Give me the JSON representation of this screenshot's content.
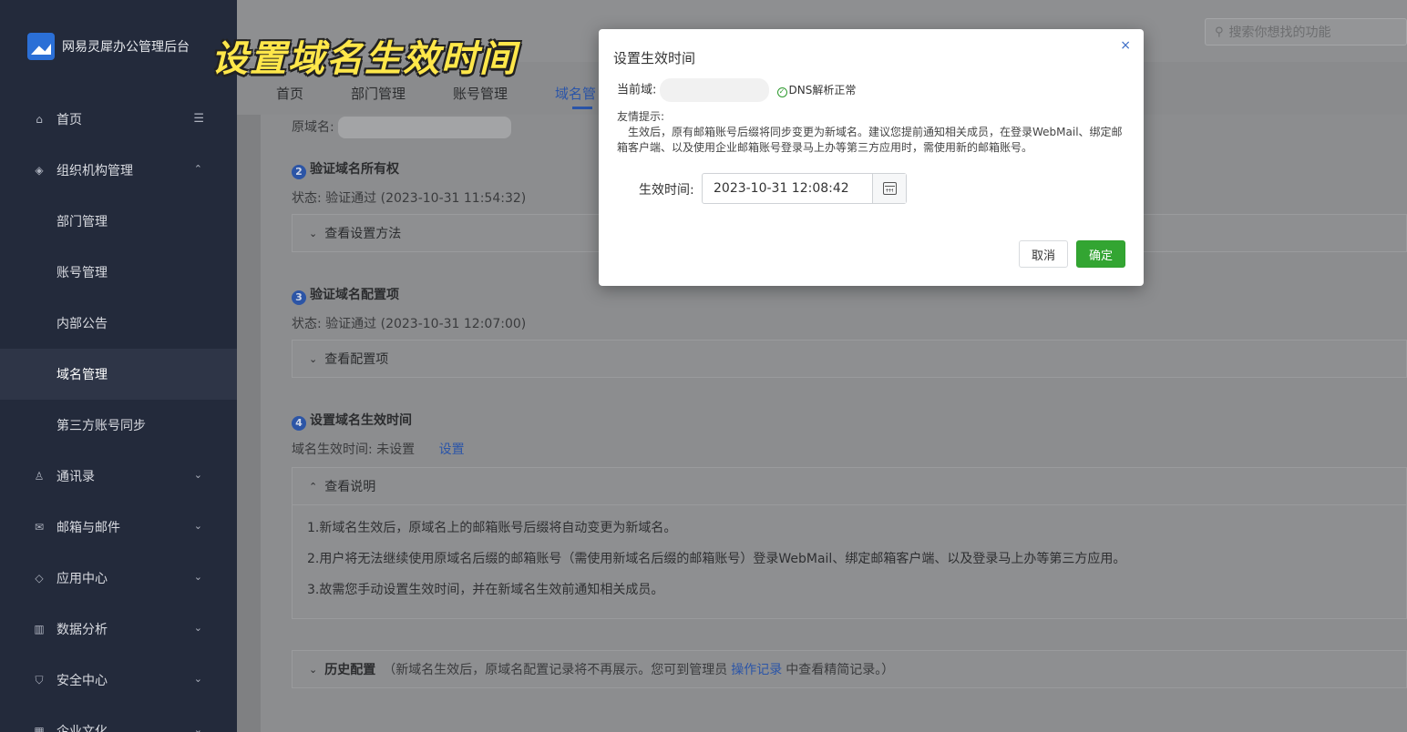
{
  "overlay_title": "设置域名生效时间",
  "sidebar": {
    "brand": "网易灵犀办公管理后台",
    "items": [
      {
        "label": "首页",
        "icon": "home-icon",
        "glyph": "⌂",
        "type": "top",
        "extra": "collapse"
      },
      {
        "label": "组织机构管理",
        "icon": "layers-icon",
        "glyph": "◈",
        "type": "top",
        "arrow": "^"
      },
      {
        "label": "部门管理",
        "type": "sub"
      },
      {
        "label": "账号管理",
        "type": "sub"
      },
      {
        "label": "内部公告",
        "type": "sub"
      },
      {
        "label": "域名管理",
        "type": "sub",
        "active": true
      },
      {
        "label": "第三方账号同步",
        "type": "sub"
      },
      {
        "label": "通讯录",
        "icon": "user-icon",
        "glyph": "♙",
        "type": "top",
        "arrow": "v"
      },
      {
        "label": "邮箱与邮件",
        "icon": "mail-icon",
        "glyph": "✉",
        "type": "top",
        "arrow": "v"
      },
      {
        "label": "应用中心",
        "icon": "diamond-icon",
        "glyph": "◇",
        "type": "top",
        "arrow": "v"
      },
      {
        "label": "数据分析",
        "icon": "chart-icon",
        "glyph": "▥",
        "type": "top",
        "arrow": "v"
      },
      {
        "label": "安全中心",
        "icon": "shield-icon",
        "glyph": "⛉",
        "type": "top",
        "arrow": "v"
      },
      {
        "label": "企业文化",
        "icon": "culture-icon",
        "glyph": "▦",
        "type": "top",
        "arrow": "v"
      }
    ]
  },
  "header": {
    "search_placeholder": "搜索你想找的功能",
    "tabs": [
      "首页",
      "部门管理",
      "账号管理",
      "域名管"
    ]
  },
  "content": {
    "original_domain_label": "原域名:",
    "step2": {
      "num": "2",
      "title": "验证域名所有权",
      "status": "状态:  验证通过  (2023-10-31 11:54:32)",
      "collapse": "查看设置方法"
    },
    "step3": {
      "num": "3",
      "title": "验证域名配置项",
      "status": "状态: 验证通过 (2023-10-31 12:07:00)",
      "collapse": "查看配置项"
    },
    "step4": {
      "num": "4",
      "title": "设置域名生效时间",
      "status": "域名生效时间: 未设置",
      "set_link": "设置",
      "collapse": "查看说明"
    },
    "notes": [
      "1.新域名生效后，原域名上的邮箱账号后缀将自动变更为新域名。",
      "2.用户将无法继续使用原域名后缀的邮箱账号（需使用新域名后缀的邮箱账号）登录WebMail、绑定邮箱客户端、以及登录马上办等第三方应用。",
      "3.故需您手动设置生效时间，并在新域名生效前通知相关成员。"
    ],
    "history": {
      "title": "历史配置",
      "note_before": "（新域名生效后，原域名配置记录将不再展示。您可到管理员",
      "link": "操作记录",
      "note_after": "中查看精简记录。）"
    }
  },
  "modal": {
    "title": "设置生效时间",
    "close": "×",
    "current_domain_label": "当前域:",
    "dns_status": "DNS解析正常",
    "hint_title": "友情提示:",
    "hint_body": "生效后，原有邮箱账号后缀将同步变更为新域名。建议您提前通知相关成员，在登录WebMail、绑定邮箱客户端、以及使用企业邮箱账号登录马上办等第三方应用时，需使用新的邮箱账号。",
    "field_label": "生效时间:",
    "date_value": "2023-10-31 12:08:42",
    "cancel": "取消",
    "confirm": "确定"
  },
  "colors": {
    "sidebar_bg": "#232a3b",
    "accent": "#2b55a8",
    "confirm_green": "#33a532"
  }
}
